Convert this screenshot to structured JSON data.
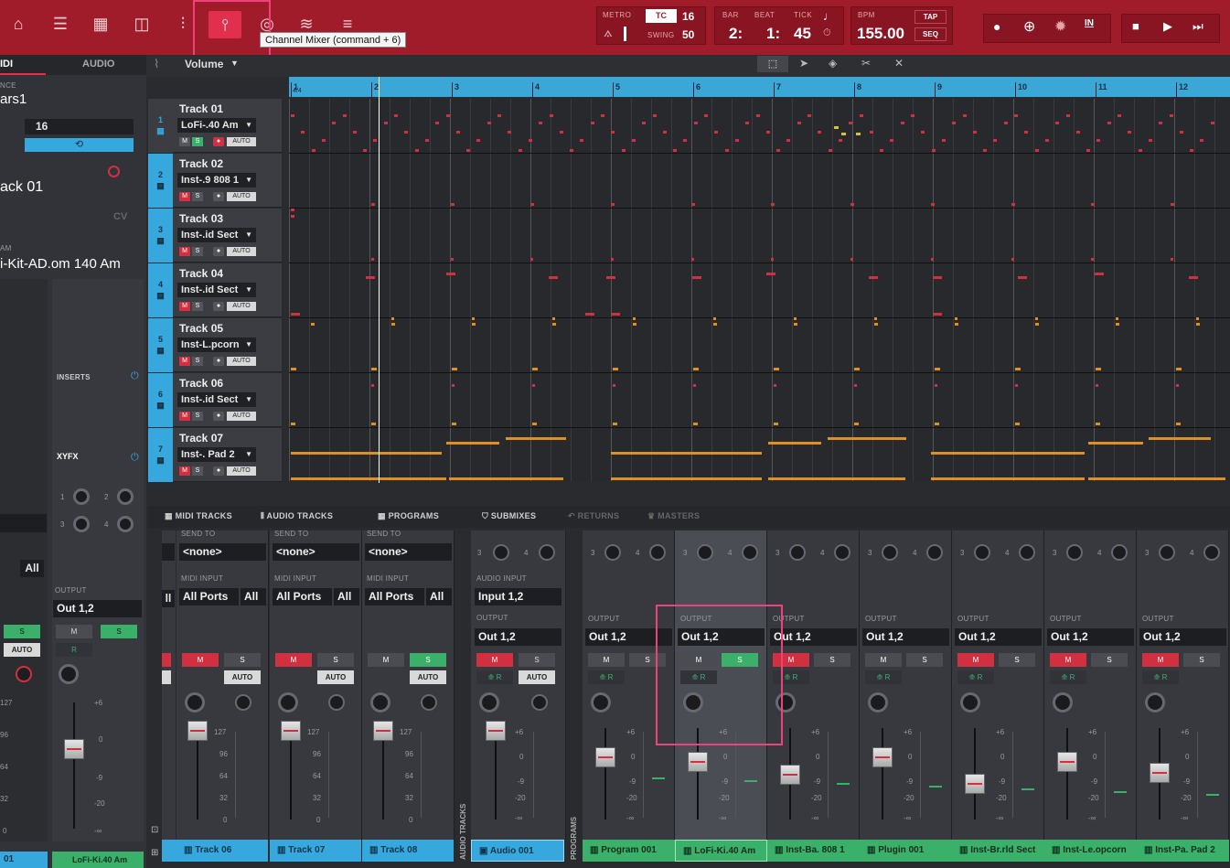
{
  "toolbar": {
    "tooltip": "Channel Mixer (command + 6)",
    "metro_label": "METRO",
    "tc_label": "TC",
    "tc_value": "16",
    "swing_label": "SWING",
    "swing_value": "50",
    "bar_label": "BAR",
    "beat_label": "BEAT",
    "tick_label": "TICK",
    "bar_value": "2:",
    "beat_value": "1:",
    "tick_value": "45",
    "bpm_label": "BPM",
    "bpm_value": "155.00",
    "tap_label": "TAP",
    "seq_label": "SEQ",
    "in_label": "IN"
  },
  "left": {
    "tab_midi": "IDI",
    "tab_audio": "AUDIO",
    "seq_label": "NCE",
    "seq_name": "ars1",
    "bars_value": "16",
    "track_name": "ack 01",
    "cv_label": "CV",
    "program_label": "AM",
    "program_name": "i-Kit-AD.om 140 Am",
    "inserts_label": "INSERTS",
    "xyfx_label": "XYFX",
    "knob_labels": [
      "1",
      "2",
      "3",
      "4"
    ],
    "all_label": "All",
    "output_label": "OUTPUT",
    "output_value": "Out 1,2",
    "m_label": "M",
    "s_label": "S",
    "r_label": "R",
    "auto_label": "AUTO",
    "scale_left": [
      "127",
      "96",
      "64",
      "32",
      "0"
    ],
    "scale_right": [
      "+6",
      "0",
      "-9",
      "-20",
      "-∞"
    ],
    "footer_left": "01",
    "footer_name": "LoFi-Ki.40 Am"
  },
  "editor": {
    "param": "Volume",
    "ruler_marks": [
      "1",
      "2",
      "3",
      "4",
      "5",
      "6",
      "7",
      "8",
      "9",
      "10",
      "11",
      "12"
    ],
    "time_sig": "4/4"
  },
  "tracks": [
    {
      "num": "1",
      "title": "Track 01",
      "inst": "LoFi-.40 Am",
      "m": "M",
      "s": "S",
      "auto": "AUTO"
    },
    {
      "num": "2",
      "title": "Track 02",
      "inst": "Inst-.9 808 1",
      "m": "M",
      "s": "S",
      "auto": "AUTO"
    },
    {
      "num": "3",
      "title": "Track 03",
      "inst": "Inst-.id Sect",
      "m": "M",
      "s": "S",
      "auto": "AUTO"
    },
    {
      "num": "4",
      "title": "Track 04",
      "inst": "Inst-.id Sect",
      "m": "M",
      "s": "S",
      "auto": "AUTO"
    },
    {
      "num": "5",
      "title": "Track 05",
      "inst": "Inst-L.pcorn",
      "m": "M",
      "s": "S",
      "auto": "AUTO"
    },
    {
      "num": "6",
      "title": "Track 06",
      "inst": "Inst-.id Sect",
      "m": "M",
      "s": "S",
      "auto": "AUTO"
    },
    {
      "num": "7",
      "title": "Track 07",
      "inst": "Inst-. Pad 2",
      "m": "M",
      "s": "S",
      "auto": "AUTO"
    }
  ],
  "mixer_tabs": [
    "MIDI TRACKS",
    "AUDIO TRACKS",
    "PROGRAMS",
    "SUBMIXES",
    "RETURNS",
    "MASTERS"
  ],
  "midi_channels": [
    {
      "send_label": "SEND TO",
      "send": "<none>",
      "input_label": "MIDI INPUT",
      "input": "All Ports",
      "all": "All",
      "m": "M",
      "s": "S",
      "auto": "AUTO",
      "name": "Track 06"
    },
    {
      "send_label": "SEND TO",
      "send": "<none>",
      "input_label": "MIDI INPUT",
      "input": "All Ports",
      "all": "All",
      "m": "M",
      "s": "S",
      "auto": "AUTO",
      "name": "Track 07"
    },
    {
      "send_label": "SEND TO",
      "send": "<none>",
      "input_label": "MIDI INPUT",
      "input": "All Ports",
      "all": "All",
      "m": "M",
      "s": "S",
      "auto": "AUTO",
      "name": "Track 08"
    }
  ],
  "audio_channel": {
    "input_label": "AUDIO INPUT",
    "input": "Input 1,2",
    "output_label": "OUTPUT",
    "output": "Out 1,2",
    "m": "M",
    "s": "S",
    "r": "R",
    "auto": "AUTO",
    "name": "Audio 001"
  },
  "program_channels": [
    {
      "output": "Out 1,2",
      "name": "Program 001"
    },
    {
      "output": "Out 1,2",
      "name": "LoFi-Ki.40 Am"
    },
    {
      "output": "Out 1,2",
      "name": "Inst-Ba. 808 1"
    },
    {
      "output": "Out 1,2",
      "name": "Plugin 001"
    },
    {
      "output": "Out 1,2",
      "name": "Inst-Br.rld Sect"
    },
    {
      "output": "Out 1,2",
      "name": "Inst-Le.opcorn"
    },
    {
      "output": "Out 1,2",
      "name": "Inst-Pa. Pad 2"
    }
  ],
  "channel_common": {
    "output_label": "OUTPUT",
    "m": "M",
    "s": "S",
    "r": "R",
    "send3": "3",
    "send4": "4"
  },
  "side_labels": {
    "audio_tracks": "AUDIO TRACKS",
    "programs": "PROGRAMS"
  },
  "scales": {
    "midi": [
      "127",
      "96",
      "64",
      "32",
      "0"
    ],
    "db": [
      "+6",
      "0",
      "-9",
      "-20",
      "-∞"
    ]
  }
}
